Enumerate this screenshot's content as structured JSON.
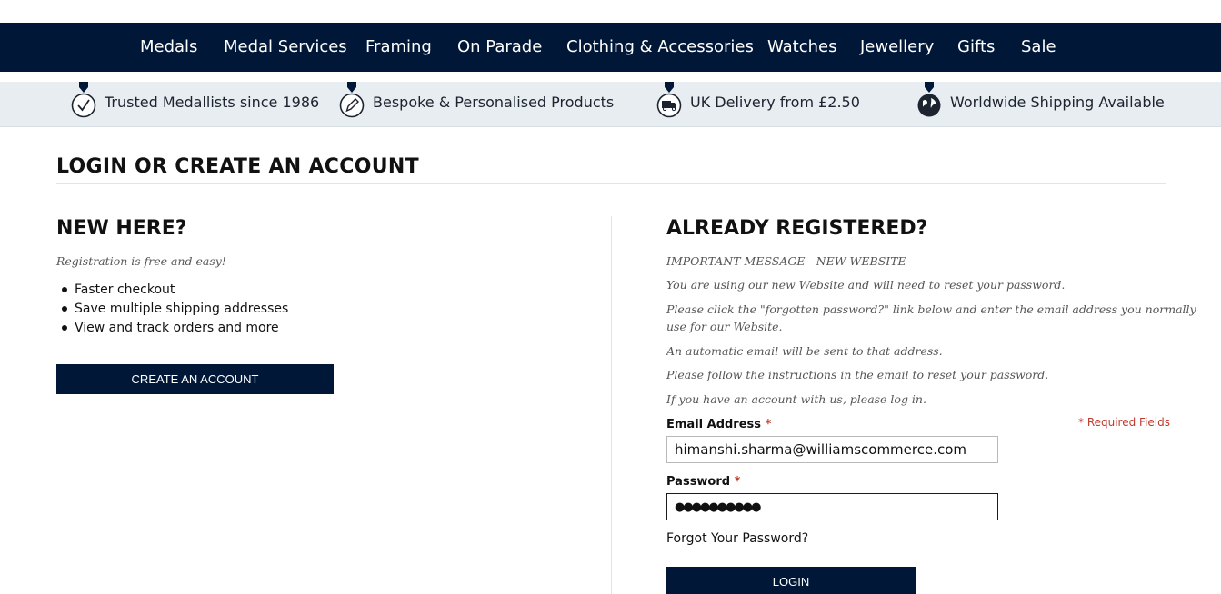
{
  "nav": {
    "items": [
      "Medals",
      "Medal Services",
      "Framing",
      "On Parade",
      "Clothing & Accessories",
      "Watches",
      "Jewellery",
      "Gifts",
      "Sale"
    ]
  },
  "usp": {
    "items": [
      {
        "label": "Trusted Medallists since 1986",
        "icon": "checkmark-medal-icon"
      },
      {
        "label": "Bespoke & Personalised Products",
        "icon": "pencil-medal-icon"
      },
      {
        "label": "UK Delivery from £2.50",
        "icon": "truck-medal-icon"
      },
      {
        "label": "Worldwide Shipping Available",
        "icon": "globe-medal-icon"
      }
    ]
  },
  "page": {
    "title": "LOGIN OR CREATE AN ACCOUNT"
  },
  "new_customer": {
    "heading": "NEW HERE?",
    "intro": "Registration is free and easy!",
    "benefits": [
      "Faster checkout",
      "Save multiple shipping addresses",
      "View and track orders and more"
    ],
    "create_button": "CREATE AN ACCOUNT"
  },
  "login": {
    "heading": "ALREADY REGISTERED?",
    "messages": [
      "IMPORTANT MESSAGE - NEW WEBSITE",
      "You are using our new Website and will need to reset your password.",
      "Please click the \"forgotten password?\" link below and enter the email address you normally",
      "use for our Website.",
      "An automatic email will be sent to that address.",
      "Please follow the instructions in the email to reset your password.",
      "If you have an account with us, please log in."
    ],
    "required_note": "* Required Fields",
    "email_label": "Email Address",
    "email_value": "himanshi.sharma@williamscommerce.com",
    "password_label": "Password",
    "password_value": "●●●●●●●●●●",
    "required_marker": "*",
    "forgot_link": "Forgot Your Password?",
    "login_button": "LOGIN"
  },
  "colors": {
    "navy": "#001738",
    "usp_bg": "#e8edf1",
    "required": "#c0392b"
  }
}
